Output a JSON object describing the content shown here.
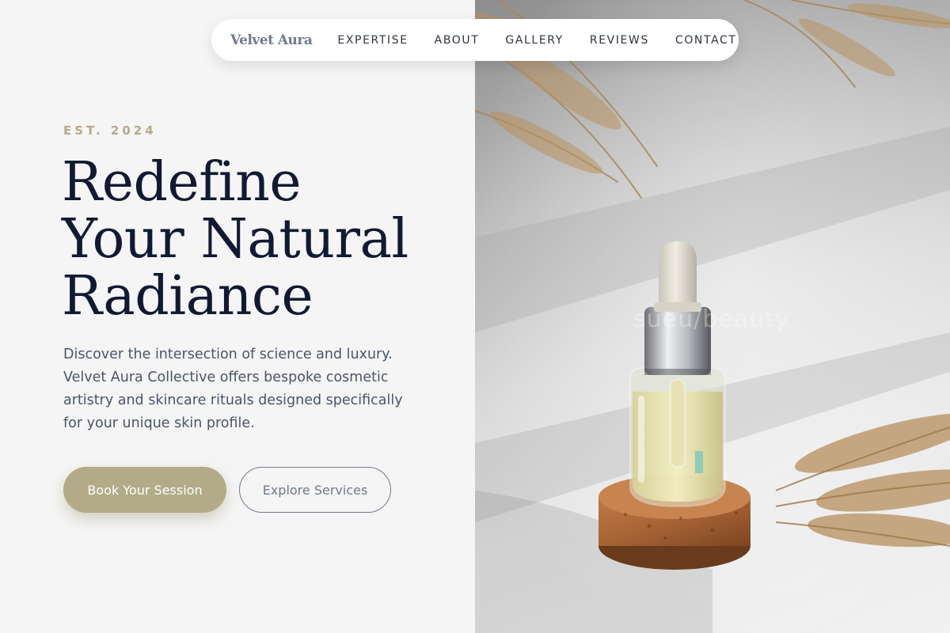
{
  "nav": {
    "logo": "Velvet Aura",
    "links": [
      "EXPERTISE",
      "ABOUT",
      "GALLERY",
      "REVIEWS",
      "CONTACT"
    ]
  },
  "hero": {
    "eyebrow": "EST. 2024",
    "headline": [
      "Redefine",
      "Your Natural",
      "Radiance"
    ],
    "description": "Discover the intersection of science and luxury. Velvet Aura Collective offers bespoke cosmetic artistry and skincare rituals designed specifically for your unique skin profile.",
    "primary_cta": "Book Your Session",
    "secondary_cta": "Explore Services"
  },
  "image": {
    "watermark": "sueu/beauty",
    "subject": "serum dropper bottle on cork stand with dried pampas grass"
  },
  "colors": {
    "accent": "#b3ab88",
    "heading": "#111a33",
    "body_text": "#4b5467",
    "muted": "#6e7b8e",
    "background": "#f5f5f5"
  }
}
